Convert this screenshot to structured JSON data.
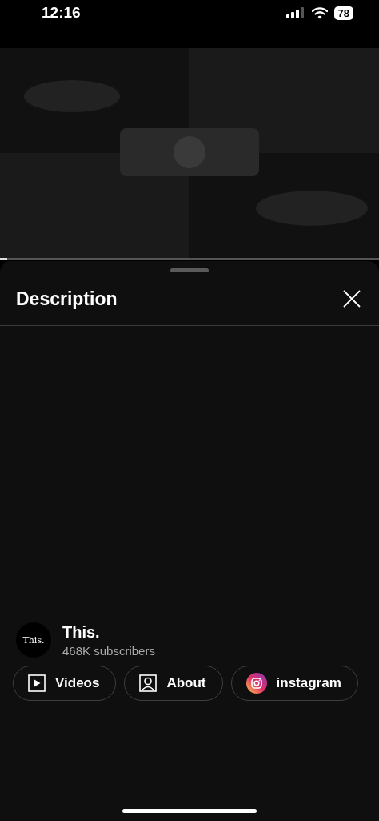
{
  "status_bar": {
    "time": "12:16",
    "battery": "78"
  },
  "player": {
    "kind": "picture",
    "progress": {
      "level": 0.02
    }
  },
  "sheet": {
    "title": "Description"
  },
  "channel": {
    "avatar_text": "This.",
    "name": "This.",
    "subscribers": "468K subscribers"
  },
  "links": [
    {
      "kind": "videos",
      "label": "Videos"
    },
    {
      "kind": "about",
      "label": "About"
    },
    {
      "kind": "instagram",
      "label": "instagram"
    }
  ]
}
